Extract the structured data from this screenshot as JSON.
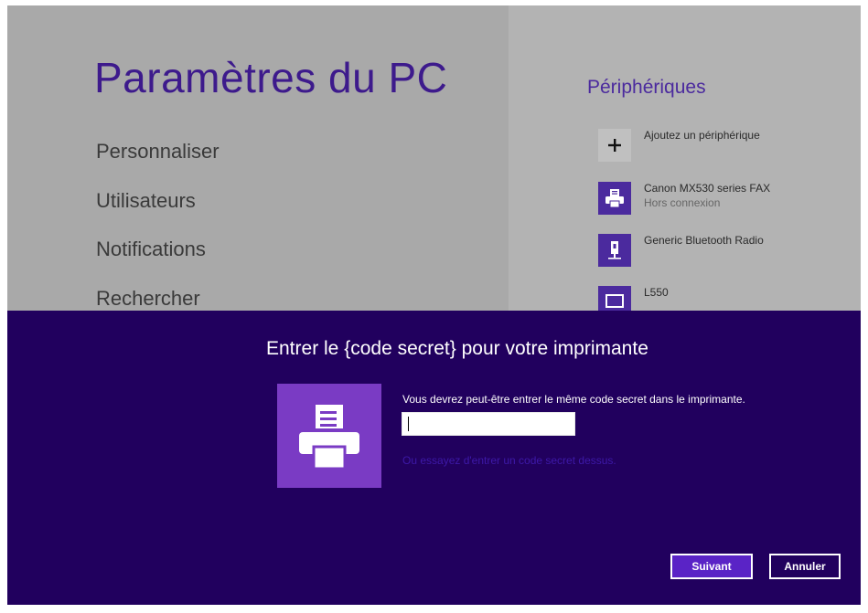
{
  "settings": {
    "title": "Paramètres du PC",
    "nav": [
      "Personnaliser",
      "Utilisateurs",
      "Notifications",
      "Rechercher"
    ]
  },
  "devices": {
    "section_title": "Périphériques",
    "add_label": "Ajoutez un périphérique",
    "items": [
      {
        "name": "Canon MX530 series FAX",
        "status": "Hors connexion",
        "icon": "printer-icon"
      },
      {
        "name": "Generic Bluetooth Radio",
        "status": "",
        "icon": "bluetooth-radio-icon"
      },
      {
        "name": "L550",
        "status": "",
        "icon": "monitor-icon"
      }
    ]
  },
  "dialog": {
    "title": "Entrer le {code secret} pour votre imprimante",
    "description": "Vous devrez peut-être entrer le même code secret dans le imprimante.",
    "pin_value": "",
    "alt_link": "Ou essayez d'entrer un code secret dessus.",
    "next_label": "Suivant",
    "cancel_label": "Annuler"
  },
  "colors": {
    "accent": "#4b2a9e",
    "dialog_bg": "#21005e",
    "tile": "#7a3bc4",
    "next_button": "#5a23c6"
  }
}
